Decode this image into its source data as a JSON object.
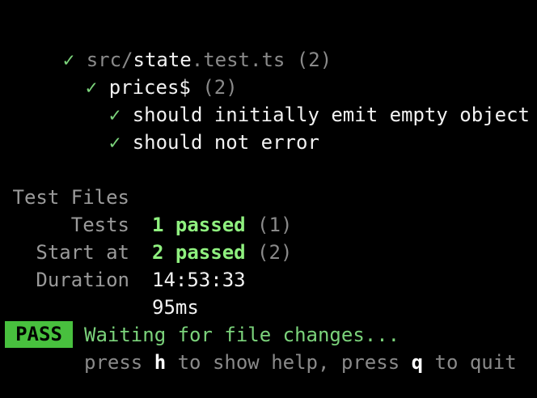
{
  "tree": {
    "file": {
      "check": "✓",
      "dir": "src/",
      "name": "state",
      "ext": ".test.ts",
      "count": "(2)"
    },
    "suite": {
      "check": "✓",
      "name": "prices$",
      "count": "(2)"
    },
    "tests": [
      {
        "check": "✓",
        "name": "should initially emit empty object"
      },
      {
        "check": "✓",
        "name": "should not error"
      }
    ]
  },
  "summary": {
    "test_files": {
      "label": "Test Files",
      "value": "1 passed",
      "total": "(1)"
    },
    "tests": {
      "label": "Tests",
      "value": "2 passed",
      "total": "(2)"
    },
    "start_at": {
      "label": "Start at",
      "value": "14:53:33"
    },
    "duration": {
      "label": "Duration",
      "value": "95ms"
    }
  },
  "status": {
    "badge": "PASS",
    "message": "Waiting for file changes...",
    "help": {
      "press1": "press ",
      "key_help": "h",
      "mid": " to show help, press ",
      "key_quit": "q",
      "end": " to quit"
    }
  },
  "colors": {
    "background": "#000000",
    "pass_badge": "#48c03e",
    "check": "#7bd37b",
    "passed": "#8ff07f"
  }
}
